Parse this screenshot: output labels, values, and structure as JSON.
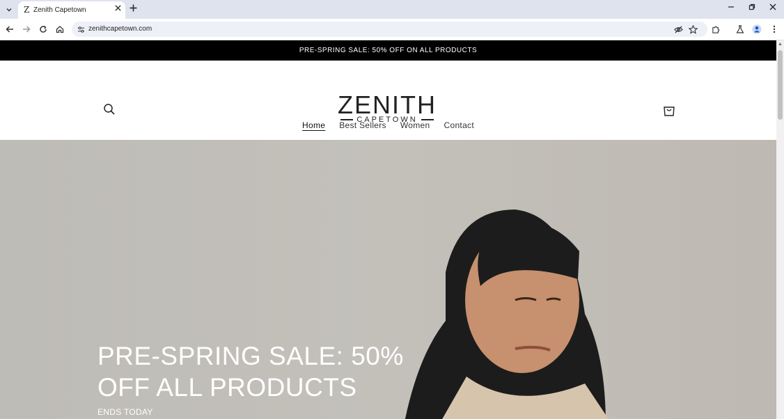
{
  "browser": {
    "tab_title": "Zenith Capetown",
    "tab_favicon": "Z",
    "url": "zenithcapetown.com",
    "icons": {
      "tab_list": "chevron-down-icon",
      "close": "close-icon",
      "new_tab": "plus-icon",
      "back": "back-arrow-icon",
      "forward": "forward-arrow-icon",
      "reload": "reload-icon",
      "home": "home-icon",
      "site_info": "tune-icon",
      "eye_off": "eye-off-icon",
      "bookmark": "star-icon",
      "extensions": "puzzle-icon",
      "labs": "flask-icon",
      "profile": "avatar-icon",
      "menu": "kebab-menu-icon"
    }
  },
  "store": {
    "announcement": "PRE-SPRING SALE: 50% OFF ON ALL PRODUCTS",
    "logo_main": "ZENITH",
    "logo_sub": "CAPETOWN",
    "nav": [
      "Home",
      "Best Sellers",
      "Women",
      "Contact"
    ],
    "active_nav": "Home",
    "hero": {
      "headline": "PRE-SPRING SALE: 50% OFF ALL PRODUCTS",
      "subheading": "ENDS TODAY"
    }
  },
  "colors": {
    "announcement_bg": "#000000",
    "tabstrip_bg": "#dfe3ee",
    "omnibox_bg": "#edf0f7",
    "hero_bg": "#c0bdb7"
  }
}
